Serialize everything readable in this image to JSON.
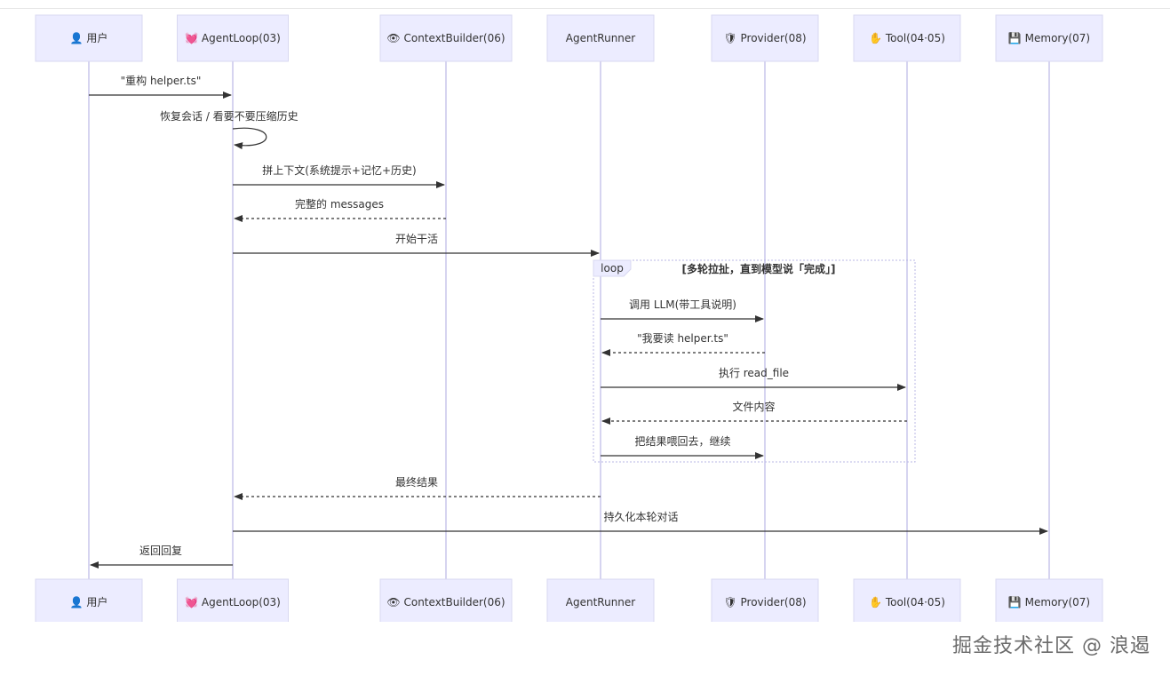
{
  "participants": [
    {
      "id": "user",
      "icon": "👤",
      "icon_name": "user-icon",
      "label": "用户"
    },
    {
      "id": "loop",
      "icon": "💓",
      "icon_name": "heart-icon",
      "label": "AgentLoop(03)"
    },
    {
      "id": "ctx",
      "icon": "👁",
      "icon_name": "eye-icon",
      "label": "ContextBuilder(06)"
    },
    {
      "id": "runner",
      "icon": "",
      "icon_name": "",
      "label": "AgentRunner"
    },
    {
      "id": "provider",
      "icon": "🛡",
      "icon_name": "shield-icon",
      "label": "Provider(08)"
    },
    {
      "id": "tool",
      "icon": "✋",
      "icon_name": "hand-icon",
      "label": "Tool(04·05)"
    },
    {
      "id": "memory",
      "icon": "💾",
      "icon_name": "floppy-disk-icon",
      "label": "Memory(07)"
    }
  ],
  "messages": [
    {
      "from": "user",
      "to": "loop",
      "text": "\"重构 helper.ts\"",
      "style": "solid"
    },
    {
      "from": "loop",
      "to": "loop",
      "text": "恢复会话 / 看要不要压缩历史",
      "style": "self"
    },
    {
      "from": "loop",
      "to": "ctx",
      "text": "拼上下文(系统提示+记忆+历史)",
      "style": "solid"
    },
    {
      "from": "ctx",
      "to": "loop",
      "text": "完整的 messages",
      "style": "dashed"
    },
    {
      "from": "loop",
      "to": "runner",
      "text": "开始干活",
      "style": "solid"
    },
    {
      "from": "runner",
      "to": "provider",
      "text": "调用 LLM(带工具说明)",
      "style": "solid"
    },
    {
      "from": "provider",
      "to": "runner",
      "text": "\"我要读 helper.ts\"",
      "style": "dashed"
    },
    {
      "from": "runner",
      "to": "tool",
      "text": "执行 read_file",
      "style": "solid"
    },
    {
      "from": "tool",
      "to": "runner",
      "text": "文件内容",
      "style": "dashed"
    },
    {
      "from": "runner",
      "to": "provider",
      "text": "把结果喂回去，继续",
      "style": "solid"
    },
    {
      "from": "runner",
      "to": "loop",
      "text": "最终结果",
      "style": "dashed"
    },
    {
      "from": "loop",
      "to": "memory",
      "text": "持久化本轮对话",
      "style": "solid"
    },
    {
      "from": "loop",
      "to": "user",
      "text": "返回回复",
      "style": "solid"
    }
  ],
  "loop_block": {
    "label": "loop",
    "condition": "[多轮拉扯，直到模型说「完成」]"
  },
  "watermark": "掘金技术社区 @ 浪遏",
  "colors": {
    "actor_fill": "#ECECFF",
    "actor_border": "#D8D8F0",
    "lifeline": "#C9C6EC",
    "arrow": "#333333"
  }
}
